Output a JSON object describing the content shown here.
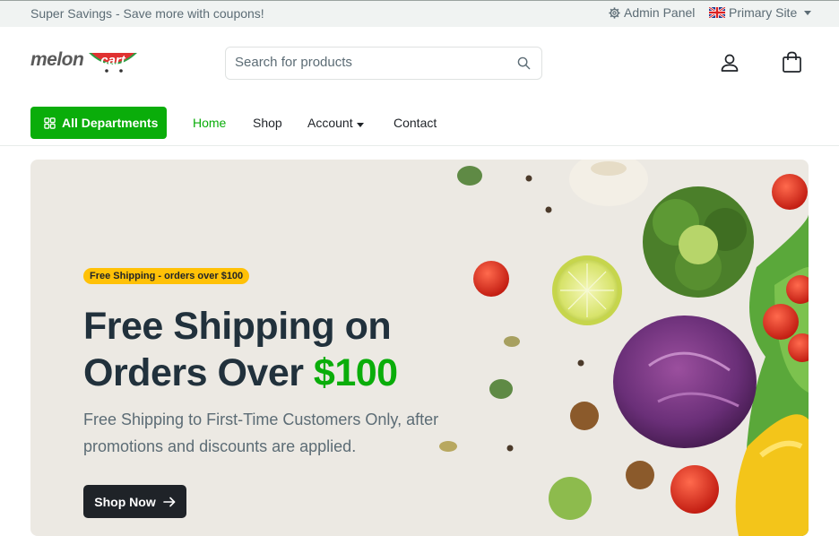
{
  "topbar": {
    "promo": "Super Savings - Save more with coupons!",
    "admin_label": "Admin Panel",
    "site_label": "Primary Site"
  },
  "header": {
    "logo_text": "melon",
    "logo_cart_text": "cart",
    "search_placeholder": "Search for products"
  },
  "nav": {
    "departments_label": "All Departments",
    "links": [
      {
        "label": "Home",
        "active": true
      },
      {
        "label": "Shop",
        "active": false
      },
      {
        "label": "Account",
        "active": false
      },
      {
        "label": "Contact",
        "active": false
      }
    ]
  },
  "hero": {
    "badge": "Free Shipping - orders over $100",
    "title_line1": "Free Shipping on",
    "title_line2_prefix": "Orders Over ",
    "title_line2_accent": "$100",
    "subtitle": "Free Shipping to First-Time Customers Only, after promotions and discounts are applied.",
    "cta": "Shop Now"
  },
  "colors": {
    "brand_green": "#0aad0a",
    "badge_yellow": "#ffc107",
    "dark": "#1f2328",
    "muted": "#5c6c75"
  }
}
